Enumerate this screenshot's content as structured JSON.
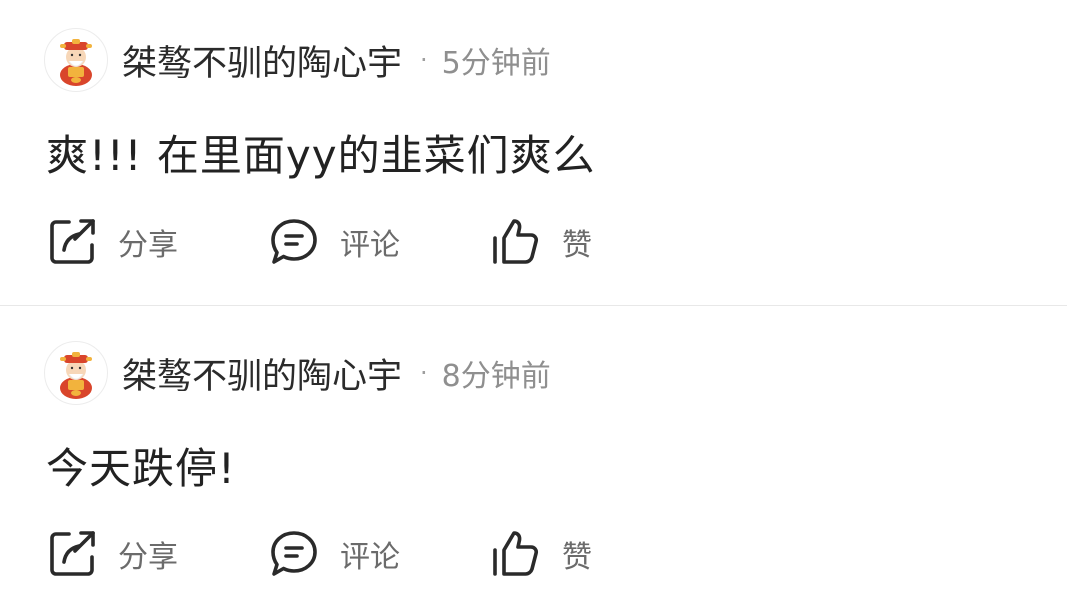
{
  "posts": [
    {
      "username": "桀骜不驯的陶心宇",
      "separator": "·",
      "time": "5分钟前",
      "content": "爽!!! 在里面yy的韭菜们爽么",
      "avatar_icon": "fortune-god-avatar-icon",
      "actions": {
        "share_label": "分享",
        "comment_label": "评论",
        "like_label": "赞"
      }
    },
    {
      "username": "桀骜不驯的陶心宇",
      "separator": "·",
      "time": "8分钟前",
      "content": "今天跌停!",
      "avatar_icon": "fortune-god-avatar-icon",
      "actions": {
        "share_label": "分享",
        "comment_label": "评论",
        "like_label": "赞"
      }
    }
  ],
  "icons": {
    "share": "share-icon",
    "comment": "comment-icon",
    "like": "thumbs-up-icon"
  },
  "colors": {
    "text_primary": "#222222",
    "text_meta": "#8f8f8f",
    "action_text": "#6b6b6b",
    "icon_stroke": "#2a2a2a",
    "divider": "#e8e8e8",
    "avatar_red": "#d9452b",
    "avatar_gold": "#f2b33d"
  }
}
